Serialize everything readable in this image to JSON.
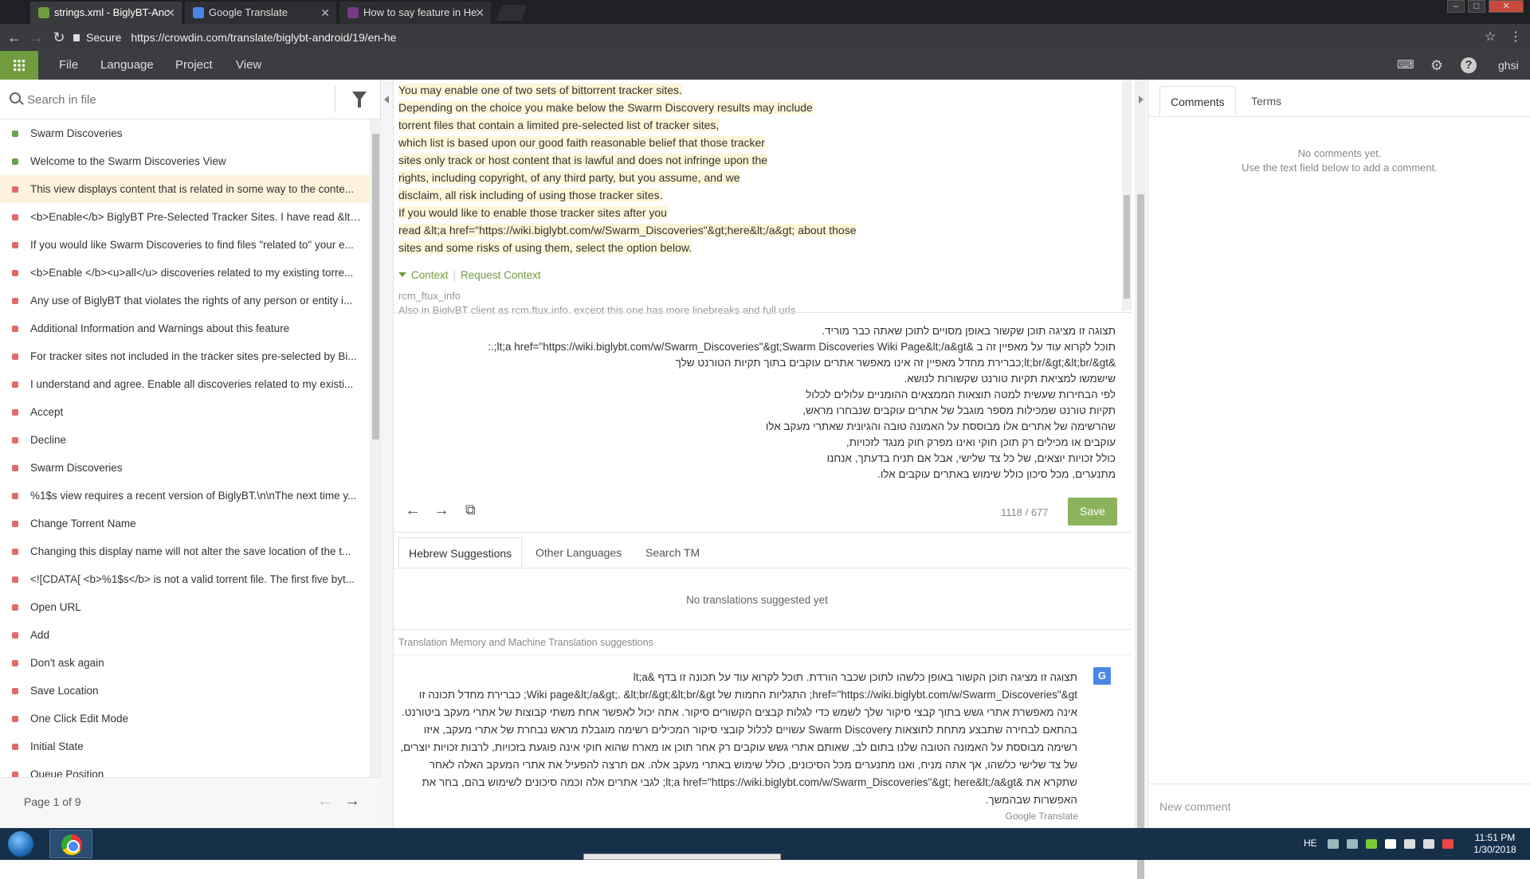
{
  "browser": {
    "tabs": [
      {
        "title": "strings.xml - BiglyBT-Anc"
      },
      {
        "title": "Google Translate"
      },
      {
        "title": "How to say feature in He"
      }
    ],
    "secure_label": "Secure",
    "url": "https://crowdin.com/translate/biglybt-android/19/en-he"
  },
  "menubar": {
    "items": [
      "File",
      "Language",
      "Project",
      "View"
    ],
    "user": "ghsi"
  },
  "left": {
    "search_placeholder": "Search in file",
    "strings": [
      {
        "text": "Swarm Discoveries",
        "status": "green"
      },
      {
        "text": "Welcome to the Swarm Discoveries View",
        "status": "green"
      },
      {
        "text": "This view displays content that is related in some way to the conte...",
        "status": "red"
      },
      {
        "text": "<b>Enable</b> BiglyBT Pre-Selected Tracker Sites. I have read &lt;...",
        "status": "red"
      },
      {
        "text": "If you would like Swarm Discoveries to find files \"related to\" your e...",
        "status": "red"
      },
      {
        "text": "<b>Enable </b><u>all</u> discoveries related to my existing torre...",
        "status": "red"
      },
      {
        "text": "Any use of BiglyBT that violates the rights of any person or entity i...",
        "status": "red"
      },
      {
        "text": "Additional Information and Warnings about this feature",
        "status": "red"
      },
      {
        "text": "For tracker sites not included in the tracker sites pre-selected by Bi...",
        "status": "red"
      },
      {
        "text": "I understand and agree. Enable all discoveries related to my existi...",
        "status": "red"
      },
      {
        "text": "Accept",
        "status": "red"
      },
      {
        "text": "Decline",
        "status": "red"
      },
      {
        "text": "Swarm Discoveries",
        "status": "red"
      },
      {
        "text": "%1$s view requires a recent version of BiglyBT.\\n\\nThe next time y...",
        "status": "red"
      },
      {
        "text": "Change Torrent Name",
        "status": "red"
      },
      {
        "text": "Changing this display name will not alter the save location of the t...",
        "status": "red"
      },
      {
        "text": "<![CDATA[ <b>%1$s</b> is not a valid torrent file. The first five byt...",
        "status": "red"
      },
      {
        "text": "Open URL",
        "status": "red"
      },
      {
        "text": "Add",
        "status": "red"
      },
      {
        "text": "Don't ask again",
        "status": "red"
      },
      {
        "text": "Save Location",
        "status": "red"
      },
      {
        "text": "One Click Edit Mode",
        "status": "red"
      },
      {
        "text": "Initial State",
        "status": "red"
      },
      {
        "text": "Queue Position",
        "status": "red"
      }
    ],
    "selected_index": 2,
    "page_label": "Page 1 of 9"
  },
  "source": {
    "lines": [
      "You may enable one of two sets of bittorrent tracker sites.",
      "Depending on the choice you make below the Swarm Discovery results may include",
      "torrent files that contain a limited pre-selected list of tracker sites,",
      "which list is based upon our good faith reasonable belief that those tracker",
      "sites only track or host content that is lawful and does not infringe upon the",
      "rights, including copyright, of any third party, but you assume, and we",
      "disclaim, all risk including of using those tracker sites.",
      "If you would like to enable those tracker sites after you",
      "read &lt;a href=\"https://wiki.biglybt.com/w/Swarm_Discoveries\"&gt;here&lt;/a&gt; about those",
      "sites and some risks of using them, select the option below."
    ],
    "context_label": "Context",
    "request_context_label": "Request Context",
    "context_key": "rcm_ftux_info",
    "context_note": "Also in BiglyBT client as rcm.ftux.info, except this one has more linebreaks and full urls"
  },
  "translation": {
    "text": "תצוגה זו מציגה תוכן שקשור באופן מסויים לתוכן שאתה כבר מוריד.\nתוכל לקרוא עוד על מאפיין זה ב &lt;a href=\"https://wiki.biglybt.com/w/Swarm_Discoveries\"&gt;Swarm Discoveries Wiki Page&lt;/a&gt;.:\n&lt;br/&gt;&lt;br/&gt;כברירת מחדל מאפיין זה אינו מאפשר אתרים עוקבים בתוך תקיות הטורנט שלך\nשישמשו למציאת תקיות טורנט שקשורות לנושא.\nלפי הבחירות שעשית למטה תוצאות הממצאים ההומניים עלולים לכלול\nתקיות טורנט שמכילות מספר מוגבל של אתרים עוקבים שנבחרו מראש,\nשהרשימה של אתרים אלו מבוססת על האמונה טובה והגיונית שאתרי מעקב אלו\nעוקבים או מכילים רק תוכן חוקי ואינו מפרק חוק מנגד לזכויות,\nכולל זכויות יוצאים, של כל צד שלישי, אבל אם תניח בדעתך, אנחנו\nמתנערים, מכל סיכון כולל שימוש באתרים עוקבים אלו.",
    "counter": "1118 / 677",
    "save_label": "Save"
  },
  "suggestions": {
    "tabs": [
      "Hebrew Suggestions",
      "Other Languages",
      "Search TM"
    ],
    "empty_message": "No translations suggested yet",
    "tm_label": "Translation Memory and Machine Translation suggestions",
    "machine_text": "תצוגה זו מציגה תוכן הקשור באופן כלשהו לתוכן שכבר הורדת. תוכל לקרוא עוד על תכונה זו בדף &lt;a href=\"https://wiki.biglybt.com/w/Swarm_Discoveries\"&gt; התגליות החמות של Wiki page&lt;/a&gt;. &lt;br/&gt;&lt;br/&gt; כברירת מחדל תכונה זו אינה מאפשרת אתרי גשש בתוך קבצי סיקור שלך לשמש כדי לגלות קבצים הקשורים סיקור. אתה יכול לאפשר אחת משתי קבוצות של אתרי מעקב ביטורנט. בהתאם לבחירה שתבצע מתחת לתוצאות Swarm Discovery עשויים לכלול קובצי סיקור המכילים רשימה מוגבלת מראש נבחרת של אתרי מעקב, איזו רשימה מבוססת על האמונה הטובה שלנו בתום לב, שאותם אתרי גשש עוקבים רק אחר תוכן או מארח שהוא חוקי אינה פוגעת בזכויות, לרבות זכויות יוצרים, של צד שלישי כלשהו, אך אתה מניח, ואנו מתנערים מכל הסיכונים, כולל שימוש באתרי מעקב אלה. אם תרצה להפעיל את אתרי המעקב האלה לאחר שתקרא את &lt;a href=\"https://wiki.biglybt.com/w/Swarm_Discoveries\"&gt; here&lt;/a&gt; לגבי אתרים אלה וכמה סיכונים לשימוש בהם, בחר את האפשרות שבהמשך.",
    "credit": "Google Translate"
  },
  "comments": {
    "tabs": [
      "Comments",
      "Terms"
    ],
    "empty_line1": "No comments yet.",
    "empty_line2": "Use the text field below to add a comment.",
    "new_placeholder": "New comment"
  },
  "taskbar": {
    "lang": "HE",
    "time": "11:51 PM",
    "date": "1/30/2018"
  }
}
